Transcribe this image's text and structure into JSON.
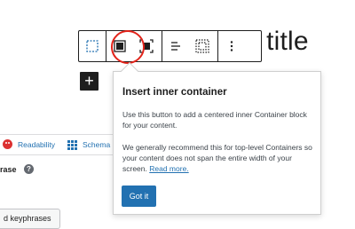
{
  "editor": {
    "post_title": "t title"
  },
  "toolbar": {
    "buttons": [
      {
        "name": "select-parent-button",
        "icon": "dashed-square-icon"
      },
      {
        "name": "container-block-button",
        "icon": "container-icon"
      },
      {
        "name": "inner-container-button",
        "icon": "inner-container-icon"
      },
      {
        "name": "align-button",
        "icon": "align-left-icon"
      },
      {
        "name": "layout-button",
        "icon": "dotted-grid-icon"
      },
      {
        "name": "more-options-button",
        "icon": "kebab-icon"
      }
    ],
    "highlight_color": "#e2231a"
  },
  "inserter": {
    "label": "+"
  },
  "popover": {
    "title": "Insert inner container",
    "paragraph1": "Use this button to add a centered inner Container block for your content.",
    "paragraph2_text": "We generally recommend this for top-level Containers so your content does not span the entire width of your screen. ",
    "paragraph2_link": "Read more.",
    "button_label": "Got it",
    "accent": "#2271b1"
  },
  "seo_panel": {
    "tabs": [
      {
        "label": "Readability",
        "icon": "sad-face-icon",
        "icon_color": "#dc3232"
      },
      {
        "label": "Schema",
        "icon": "grid-icon"
      }
    ],
    "keyphrase_label": "rase",
    "help_icon": "?",
    "related_button": "d keyphrases"
  }
}
